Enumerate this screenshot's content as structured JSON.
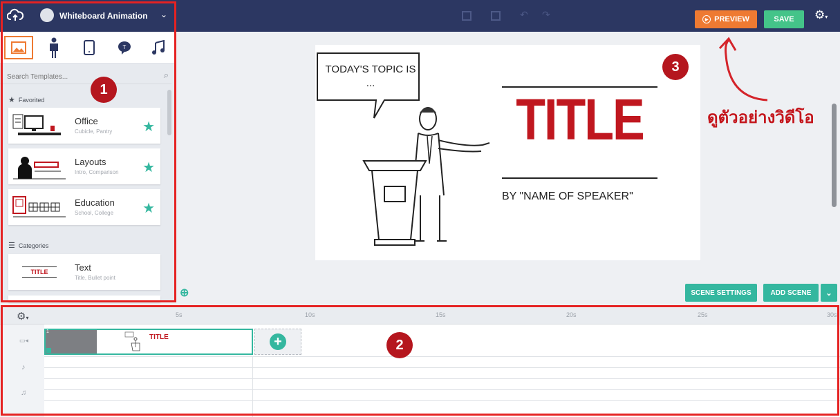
{
  "topbar": {
    "project_title": "Whiteboard Animation",
    "preview_label": "PREVIEW",
    "save_label": "SAVE"
  },
  "sidebar": {
    "search_placeholder": "Search Templates...",
    "favorited_heading": "Favorited",
    "categories_heading": "Categories",
    "favorites": [
      {
        "title": "Office",
        "subtitle": "Cubicle, Pantry"
      },
      {
        "title": "Layouts",
        "subtitle": "Intro, Comparison"
      },
      {
        "title": "Education",
        "subtitle": "School, College"
      }
    ],
    "categories": [
      {
        "title": "Text",
        "subtitle": "Title, Bullet point",
        "thumb_text": "TITLE"
      }
    ]
  },
  "canvas": {
    "speech_bubble": "TODAY'S TOPIC IS ...",
    "slide_title": "TITLE",
    "byline": "BY \"NAME OF SPEAKER\""
  },
  "buttons": {
    "scene_settings": "SCENE SETTINGS",
    "add_scene": "ADD SCENE"
  },
  "timeline": {
    "ticks": [
      "5s",
      "10s",
      "15s",
      "20s",
      "25s",
      "30s"
    ],
    "scene_number": "1",
    "thumb_title": "TITLE"
  },
  "annotations": {
    "badge_1": "1",
    "badge_2": "2",
    "badge_3": "3",
    "preview_note": "ดูตัวอย่างวิดีโอ"
  },
  "colors": {
    "topbar": "#2c3762",
    "preview_orange": "#ee7a32",
    "save_green": "#44c489",
    "teal": "#34b79f",
    "annotation_red": "#e52222",
    "title_red": "#c0171f"
  }
}
